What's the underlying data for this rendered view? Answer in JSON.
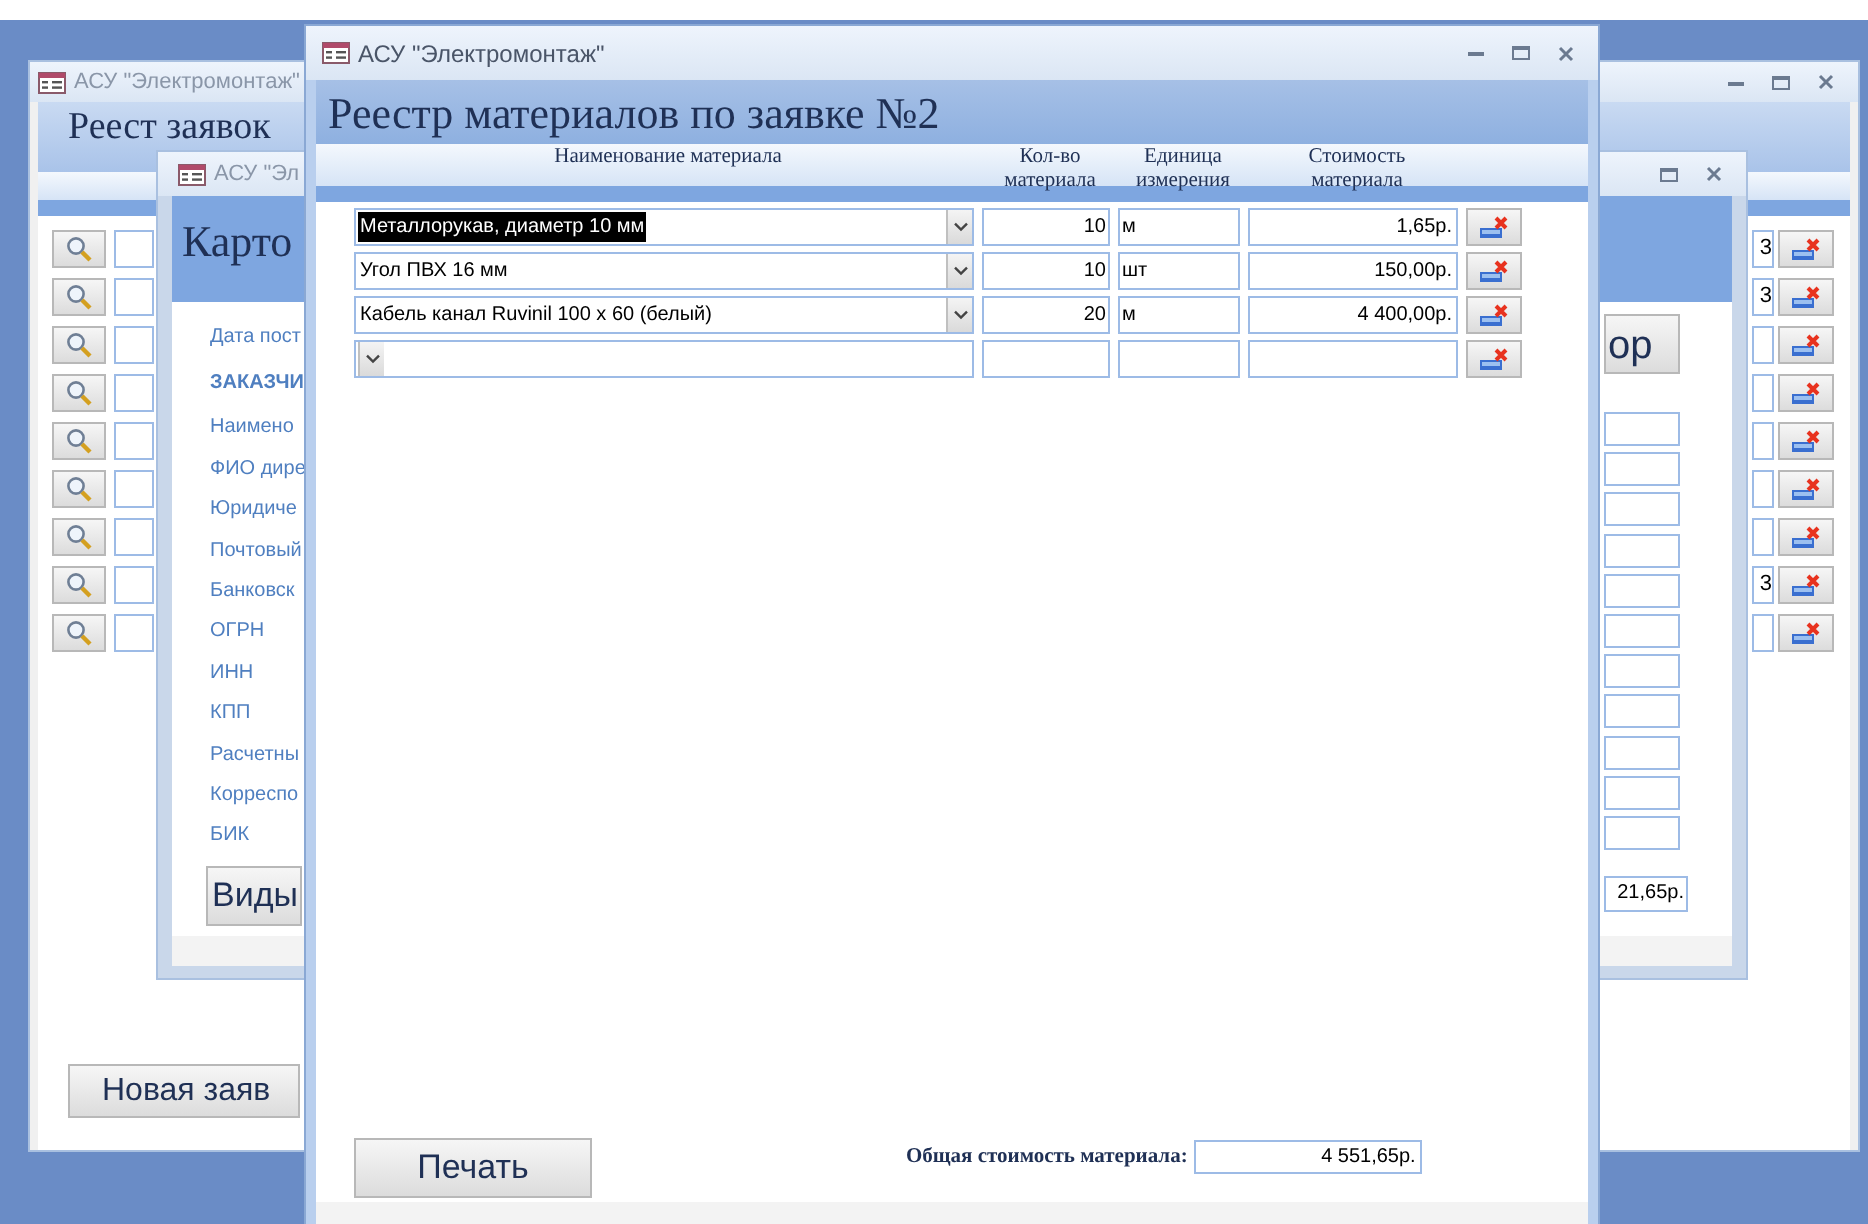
{
  "background_window": {
    "title": "АСУ \"Электромонтаж\"",
    "heading": "Реест заявок",
    "rows": [
      {
        "end_text": "3"
      },
      {
        "end_text": "3"
      },
      {},
      {},
      {},
      {},
      {},
      {
        "end_text": "3"
      },
      {}
    ],
    "new_button": "Новая заяв"
  },
  "card_window": {
    "title": "АСУ \"Эл",
    "heading": "Карто",
    "labels": [
      {
        "text": "Дата пост",
        "kind": "plain"
      },
      {
        "text": "ЗАКАЗЧИ",
        "kind": "section"
      },
      {
        "text": "Наимено",
        "kind": "plain"
      },
      {
        "text": "ФИО дире",
        "kind": "plain"
      },
      {
        "text": "Юридиче",
        "kind": "plain"
      },
      {
        "text": "Почтовый",
        "kind": "plain"
      },
      {
        "text": "Банковск",
        "kind": "plain"
      },
      {
        "text": "ОГРН",
        "kind": "plain"
      },
      {
        "text": "ИНН",
        "kind": "plain"
      },
      {
        "text": "КПП",
        "kind": "plain"
      },
      {
        "text": "Расчетны",
        "kind": "plain"
      },
      {
        "text": "Корреспо",
        "kind": "plain"
      },
      {
        "text": "БИК",
        "kind": "plain"
      }
    ],
    "types_button": "Виды",
    "side_button": "ор",
    "total": "21,65р."
  },
  "main_window": {
    "title": "АСУ \"Электромонтаж\"",
    "heading": "Реестр материалов по заявке №2",
    "columns": [
      "Наименование материала",
      "Кол-во материала",
      "Единица измерения",
      "Стоимость материала"
    ],
    "rows": [
      {
        "kind": "item",
        "name": "Металлорукав, диаметр 10 мм",
        "quantity": "10",
        "unit": "м",
        "cost": "1,65р.",
        "highlighted": true
      },
      {
        "kind": "item",
        "name": "Угол ПВХ 16 мм",
        "quantity": "10",
        "unit": "шт",
        "cost": "150,00р.",
        "highlighted": false
      },
      {
        "kind": "item",
        "name": "Кабель канал Ruvinil 100 x 60 (белый)",
        "quantity": "20",
        "unit": "м",
        "cost": "4 400,00р.",
        "highlighted": false
      },
      {
        "kind": "new"
      }
    ],
    "print_button": "Печать",
    "total_label": "Общая стоимость материала:",
    "total": "4 551,65р."
  }
}
